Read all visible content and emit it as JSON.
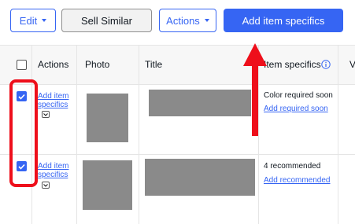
{
  "toolbar": {
    "edit_label": "Edit",
    "sell_similar_label": "Sell Similar",
    "actions_label": "Actions",
    "add_specifics_label": "Add item specifics"
  },
  "table": {
    "headers": {
      "actions": "Actions",
      "photo": "Photo",
      "title": "Title",
      "item_specifics": "Item specifics",
      "next_col": "V"
    },
    "rows": [
      {
        "selected": true,
        "action_link_line1": "Add item",
        "action_link_line2": "specifics",
        "specifics_status": "Color required soon",
        "specifics_link": "Add required soon"
      },
      {
        "selected": true,
        "action_link_line1": "Add item",
        "action_link_line2": "specifics",
        "specifics_status": "4 recommended",
        "specifics_link": "Add recommended"
      }
    ]
  },
  "colors": {
    "accent": "#3665f3",
    "annotation": "#ee0f1b",
    "placeholder": "#8a8a8a"
  },
  "icons": [
    "chevron-down-icon",
    "info-icon",
    "checkmark-icon",
    "arrow-up-icon"
  ]
}
